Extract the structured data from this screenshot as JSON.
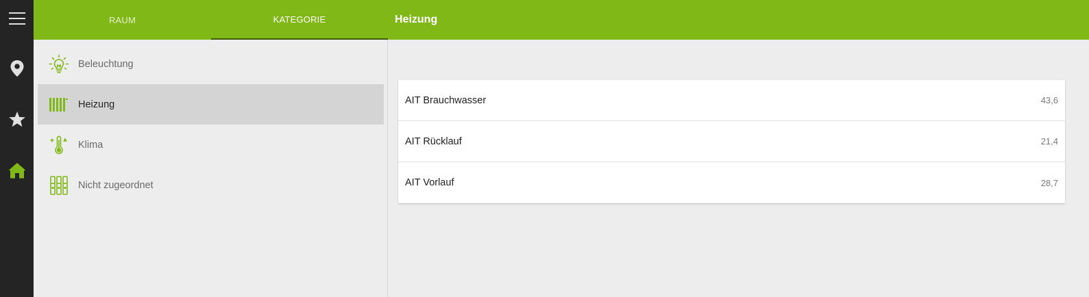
{
  "colors": {
    "accent": "#80b817",
    "rail": "#242424",
    "selected_bg": "#d4d4d4"
  },
  "rail": {
    "items": [
      {
        "icon": "menu-icon"
      },
      {
        "icon": "location-pin-icon"
      },
      {
        "icon": "star-icon"
      },
      {
        "icon": "home-icon"
      }
    ]
  },
  "header": {
    "tabs": [
      {
        "label": "Raum"
      },
      {
        "label": "Kategorie"
      }
    ],
    "title": "Heizung"
  },
  "categories": [
    {
      "label": "Beleuchtung",
      "icon": "lightbulb-icon"
    },
    {
      "label": "Heizung",
      "icon": "radiator-icon",
      "selected": true
    },
    {
      "label": "Klima",
      "icon": "thermometer-icon"
    },
    {
      "label": "Nicht zugeordnet",
      "icon": "unassigned-icon"
    }
  ],
  "readings": [
    {
      "label": "AIT Brauchwasser",
      "value": "43,6"
    },
    {
      "label": "AIT Rücklauf",
      "value": "21,4"
    },
    {
      "label": "AIT Vorlauf",
      "value": "28,7"
    }
  ]
}
